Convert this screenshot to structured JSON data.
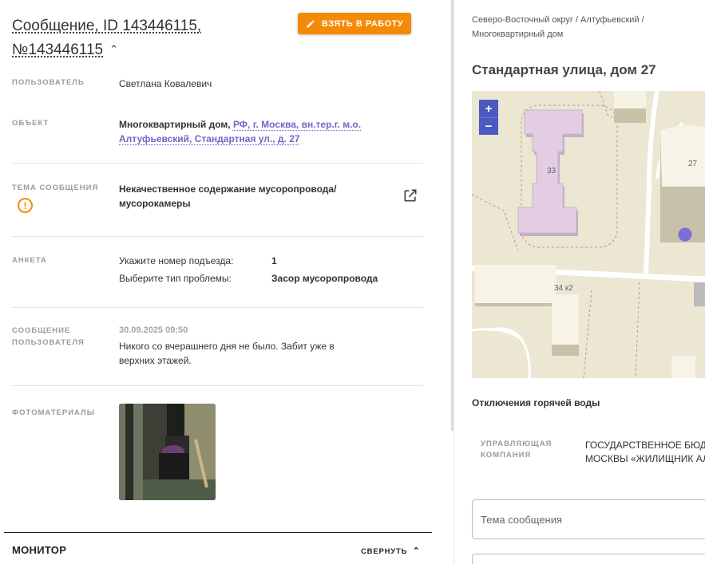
{
  "message": {
    "title_line1": "Сообщение, ID 143446115,",
    "title_line2": "№143446115",
    "take_button": "ВЗЯТЬ В РАБОТУ",
    "fields": {
      "user_label": "ПОЛЬЗОВАТЕЛЬ",
      "user_value": "Светлана Ковалевич",
      "object_label": "ОБЪЕКТ",
      "object_type": "Многоквартирный дом,",
      "object_address_1": "РФ, г. Москва, вн.тер.г. м.о.",
      "object_address_2": "Алтуфьевский, Стандартная ул., д. 27",
      "topic_label": "ТЕМА СООБЩЕНИЯ",
      "topic_line1": "Некачественное содержание мусоропровода/",
      "topic_line2": "мусорокамеры",
      "survey_label": "АНКЕТА",
      "survey": [
        {
          "q": "Укажите номер подъезда:",
          "a": "1"
        },
        {
          "q": "Выберите тип проблемы:",
          "a": "Засор мусоропровода"
        }
      ],
      "user_message_label_1": "СООБЩЕНИЕ",
      "user_message_label_2": "ПОЛЬЗОВАТЕЛЯ",
      "message_date": "30.09.2025 09:50",
      "message_text_1": "Никого со вчерашнего дня не было. Забит уже в",
      "message_text_2": "верхних этажей.",
      "photos_label": "ФОТОМАТЕРИАЛЫ"
    },
    "monitor": {
      "title": "МОНИТОР",
      "collapse": "СВЕРНУТЬ"
    }
  },
  "side": {
    "breadcrumb_1": "Северо-Восточный округ / Алтуфьевский /",
    "breadcrumb_2": "Многоквартирный дом",
    "address": "Стандартная улица, дом 27",
    "map": {
      "zoom_in": "+",
      "zoom_out": "−",
      "labels": {
        "b33": "33",
        "b27": "27",
        "b34": "34 к2"
      }
    },
    "hot_water": "Отключения горячей воды",
    "uk_label_1": "УПРАВЛЯЮЩАЯ",
    "uk_label_2": "КОМПАНИЯ",
    "uk_value_1": "ГОСУДАРСТВЕННОЕ БЮДЖ",
    "uk_value_2": "МОСКВЫ «ЖИЛИЩНИК АЛ",
    "subject_placeholder": "Тема сообщения"
  },
  "colors": {
    "accent_orange": "#f58a07",
    "link_purple": "#7b61c9",
    "map_zoom": "#4a5ac0",
    "map_bg": "#ece7d3",
    "building_highlight": "#e2cde3",
    "marker": "#7b6fd6"
  }
}
